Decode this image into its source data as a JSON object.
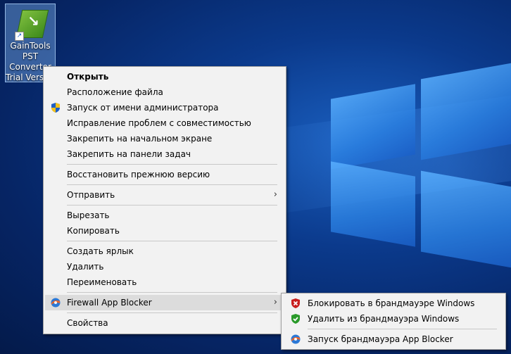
{
  "desktop_icon": {
    "label_lines": [
      "GainTools",
      "PST",
      "Converter",
      "Trial Version"
    ],
    "icon": "book-arrow-icon"
  },
  "context_menu": {
    "items": [
      {
        "label": "Открыть",
        "bold": true
      },
      {
        "label": "Расположение файла"
      },
      {
        "label": "Запуск от имени администратора",
        "icon": "uac-shield-icon"
      },
      {
        "label": "Исправление проблем с совместимостью"
      },
      {
        "label": "Закрепить на начальном экране"
      },
      {
        "label": "Закрепить на панели задач"
      },
      {
        "label": "Восстановить прежнюю версию"
      },
      {
        "label": "Отправить",
        "submenu": true
      },
      {
        "label": "Вырезать"
      },
      {
        "label": "Копировать"
      },
      {
        "label": "Создать ярлык"
      },
      {
        "label": "Удалить"
      },
      {
        "label": "Переименовать"
      },
      {
        "label": "Firewall App Blocker",
        "submenu": true,
        "highlighted": true,
        "icon": "firewall-app-blocker-icon"
      },
      {
        "label": "Свойства"
      }
    ],
    "submenu_arrow": "›"
  },
  "submenu": {
    "items": [
      {
        "label": "Блокировать в брандмауэре Windows",
        "icon": "red-shield-icon"
      },
      {
        "label": "Удалить из брандмауэра Windows",
        "icon": "green-shield-icon"
      },
      {
        "label": "Запуск брандмауэра App Blocker",
        "icon": "firewall-app-blocker-icon"
      }
    ]
  },
  "colors": {
    "menu_bg": "#f2f2f2",
    "highlight": "#dcdcdc",
    "desktop": "#0b3a8c"
  }
}
